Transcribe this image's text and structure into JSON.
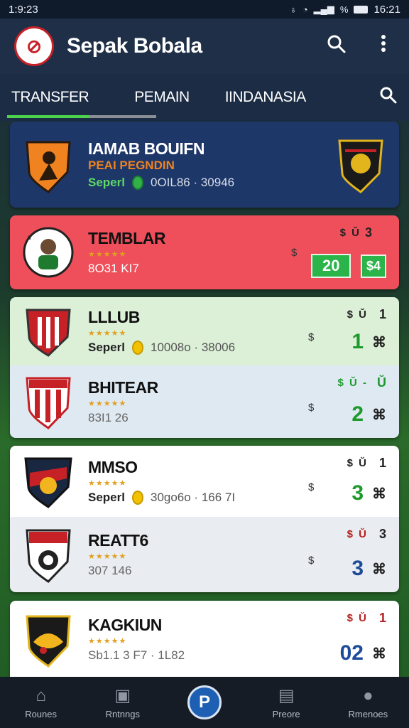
{
  "status_bar": {
    "time_left": "1:9:23",
    "time_right": "16:21",
    "signal_text": "%"
  },
  "app_bar": {
    "title": "Sepak Bobala",
    "search_icon": "search-icon",
    "menu_icon": "kebab-menu-icon"
  },
  "tabs": [
    {
      "label": "TRANSFER"
    },
    {
      "label": "PEMAIN"
    },
    {
      "label": "IINDANASIA"
    }
  ],
  "cards": {
    "featured": {
      "title": "IAMAB BOUIFN",
      "subtitle": "PEAI PEGNDIN",
      "meta_label": "Seperl",
      "meta_value": "0OIL86 · 30946",
      "bg": "#1e3769"
    },
    "highlight": {
      "name": "TEMBLAR",
      "sub": "8O31 KI7",
      "marks": "$ Ŭ",
      "mini": "3",
      "dollar": "$",
      "price": "20",
      "price2": "$4",
      "bg": "#ee4f5a"
    },
    "group1": [
      {
        "name": "LLLUB",
        "stars": "★★★★★",
        "meta_label": "Seperl",
        "meta_value": "10008o · 38006",
        "marks": "$ Ŭ",
        "mini": "1",
        "dollar": "$",
        "score": "1",
        "x": "⌘",
        "bg": "#dcefd7",
        "mark_color": "red",
        "score_color": "green"
      },
      {
        "name": "BHITEAR",
        "stars": "★★★★★",
        "sub": "83I1 26",
        "marks": "$ Ŭ -",
        "mini": "Ŭ",
        "dollar": "$",
        "score": "2",
        "x": "⌘",
        "bg": "#dfe9f2",
        "mark_color": "green",
        "score_color": "green"
      }
    ],
    "group2": [
      {
        "name": "MMSO",
        "stars": "★★★★★",
        "meta_label": "Seperl",
        "meta_value": "30go6o · 166 7I",
        "marks": "$ Ŭ",
        "mini": "1",
        "dollar": "$",
        "score": "3",
        "x": "⌘",
        "bg": "#ffffff",
        "mark_color": "black",
        "score_color": "green"
      },
      {
        "name": "REATT6",
        "stars": "★★★★★",
        "sub": "307 146",
        "marks": "$ Ŭ",
        "mini": "3",
        "dollar": "$",
        "score": "3",
        "x": "⌘",
        "bg": "#e9ecf0",
        "mark_color": "red",
        "score_color": "blue"
      }
    ],
    "group3": [
      {
        "name": "KAGKIUN",
        "stars": "★★★★★",
        "sub": "Sb1.1 3 F7 · 1L82",
        "marks": "$ Ŭ",
        "mini": "1",
        "score": "02",
        "x": "⌘",
        "bg": "#ffffff",
        "mark_color": "red",
        "score_color": "blue"
      }
    ]
  },
  "bottom_nav": [
    {
      "label": "Rounes",
      "icon": "home-icon"
    },
    {
      "label": "Rntnngs",
      "icon": "lock-icon"
    },
    {
      "label": "",
      "icon": "p-badge-icon"
    },
    {
      "label": "Preore",
      "icon": "cards-icon"
    },
    {
      "label": "Rmenoes",
      "icon": "person-icon"
    }
  ],
  "colors": {
    "green_accent": "#4cd54c",
    "score_green": "#1e9a2c",
    "score_blue": "#1d4b9a",
    "red_mark": "#b52020"
  }
}
